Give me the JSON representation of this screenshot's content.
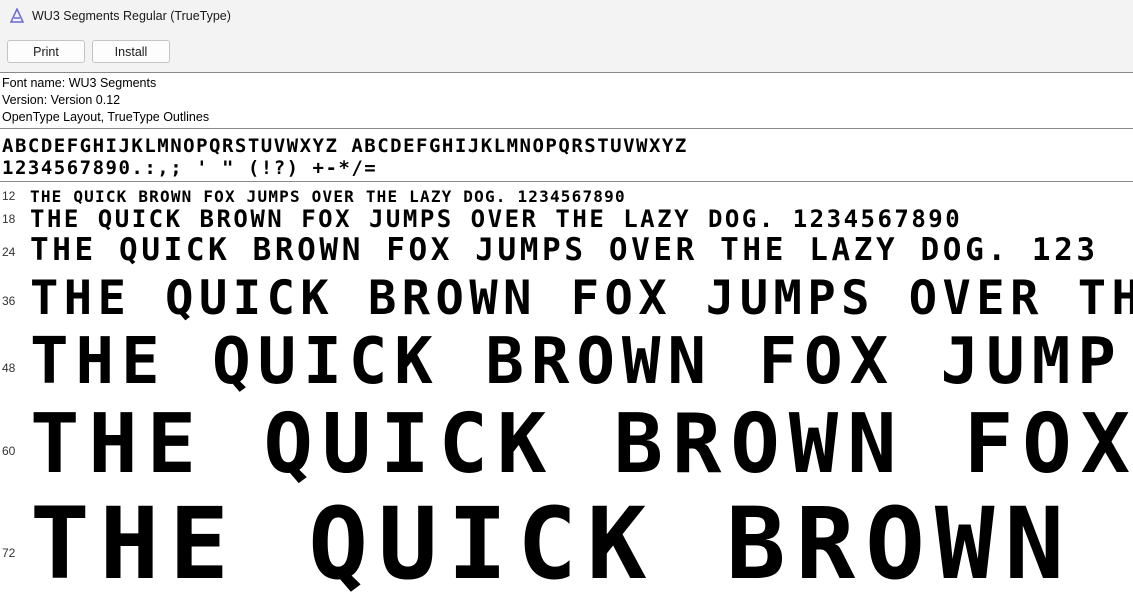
{
  "window": {
    "title": "WU3 Segments Regular (TrueType)",
    "icon": "font-viewer-icon"
  },
  "toolbar": {
    "print_label": "Print",
    "install_label": "Install"
  },
  "info": {
    "font_name": "Font name: WU3 Segments",
    "version": "Version: Version 0.12",
    "outline": "OpenType Layout, TrueType Outlines"
  },
  "charset": {
    "line1": "ABCDEFGHIJKLMNOPQRSTUVWXYZ ABCDEFGHIJKLMNOPQRSTUVWXYZ",
    "line2": "1234567890.:,; ' \" (!?) +-*/="
  },
  "samples": [
    {
      "size": "12",
      "text": "THE QUICK BROWN FOX JUMPS OVER THE LAZY DOG. 1234567890"
    },
    {
      "size": "18",
      "text": "THE QUICK BROWN FOX JUMPS OVER THE LAZY DOG. 1234567890"
    },
    {
      "size": "24",
      "text": "THE QUICK BROWN FOX JUMPS OVER THE LAZY DOG. 123"
    },
    {
      "size": "36",
      "text": "THE QUICK BROWN FOX JUMPS OVER TH"
    },
    {
      "size": "48",
      "text": "THE QUICK BROWN FOX JUMP"
    },
    {
      "size": "60",
      "text": "THE QUICK BROWN FOX"
    },
    {
      "size": "72",
      "text": "THE QUICK BROWN"
    }
  ]
}
